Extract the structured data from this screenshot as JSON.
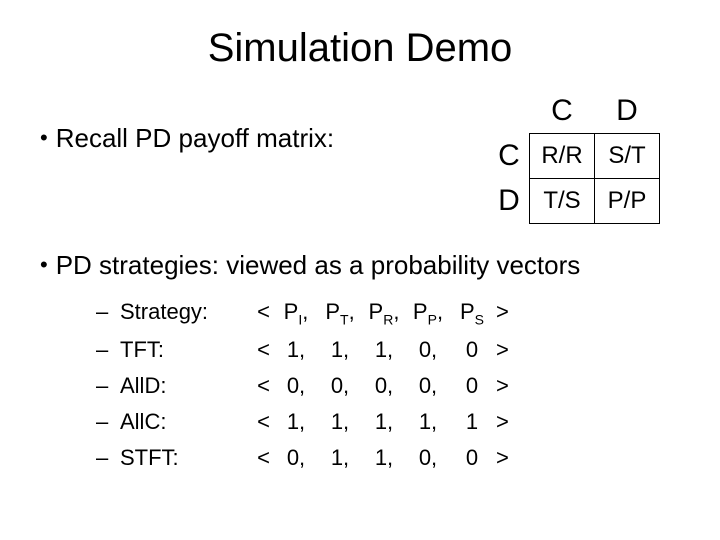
{
  "title": "Simulation Demo",
  "bullets": {
    "b1": "Recall PD payoff matrix:",
    "b2": "PD strategies: viewed as a probability vectors"
  },
  "matrix": {
    "col_headers": [
      "C",
      "D"
    ],
    "row_headers": [
      "C",
      "D"
    ],
    "cells": [
      [
        "R/R",
        "S/T"
      ],
      [
        "T/S",
        "P/P"
      ]
    ]
  },
  "vector_header": {
    "open": "<",
    "labels": [
      "P",
      "P",
      "P",
      "P",
      "P"
    ],
    "subs": [
      "I",
      "T",
      "R",
      "P",
      "S"
    ],
    "close": ">"
  },
  "strategies": [
    {
      "name": "Strategy:"
    },
    {
      "name": "TFT:",
      "v": [
        "1,",
        "1,",
        "1,",
        "0,",
        "0"
      ]
    },
    {
      "name": "AllD:",
      "v": [
        "0,",
        "0,",
        "0,",
        "0,",
        "0"
      ]
    },
    {
      "name": "AllC:",
      "v": [
        "1,",
        "1,",
        "1,",
        "1,",
        "1"
      ]
    },
    {
      "name": "STFT:",
      "v": [
        "0,",
        "1,",
        "1,",
        "0,",
        "0"
      ]
    }
  ],
  "sym": {
    "lt": "<",
    "gt": ">",
    "dash": "–",
    "bullet": "•"
  }
}
